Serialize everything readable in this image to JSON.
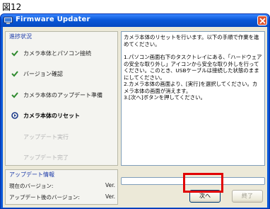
{
  "figure_label": "図12",
  "window": {
    "title": "Firmware Updater",
    "icons": {
      "app": "firmware-app-icon",
      "close": "close-icon"
    }
  },
  "steps_panel": {
    "group_title": "進捗状況",
    "steps": [
      {
        "label": "カメラ本体とパソコン接続",
        "state": "done",
        "icon": "check-icon"
      },
      {
        "label": "バージョン確認",
        "state": "done",
        "icon": "check-icon"
      },
      {
        "label": "カメラ本体のアップデート準備",
        "state": "done",
        "icon": "check-icon"
      },
      {
        "label": "カメラ本体のリセット",
        "state": "current",
        "icon": "current-step-icon"
      },
      {
        "label": "アップデート実行",
        "state": "pending",
        "icon": ""
      },
      {
        "label": "アップデート完了",
        "state": "pending",
        "icon": ""
      }
    ]
  },
  "instructions": {
    "intro": "カメラ本体のリセットを行います。以下の手順で作業を進めてください。",
    "step1": "1.パソコン画面右下のタスクトレイにある、「ハードウェアの安全な取り外し」アイコンから安全な取り外しを行ってください。このとき、USBケーブルは接続した状態のままにしてください。",
    "step2": "2.カメラ本体の画面より、[実行]を選択してください。カメラ本体の画面が消えます。",
    "step3": "3.[次へ]ボタンを押してください。"
  },
  "update_info": {
    "group_title": "アップデート情報",
    "current_version_label": "現在のバージョン:",
    "current_version_value": "Ver.",
    "after_version_label": "アップデート後のバージョン:",
    "after_version_value": "Ver."
  },
  "progress": {
    "percent": 0
  },
  "buttons": {
    "next": "次へ",
    "finish": "終了"
  },
  "colors": {
    "titlebar": "#0a58d8",
    "check": "#2f8a2f",
    "current_step": "#1b3a8a",
    "highlight": "#e10000"
  }
}
